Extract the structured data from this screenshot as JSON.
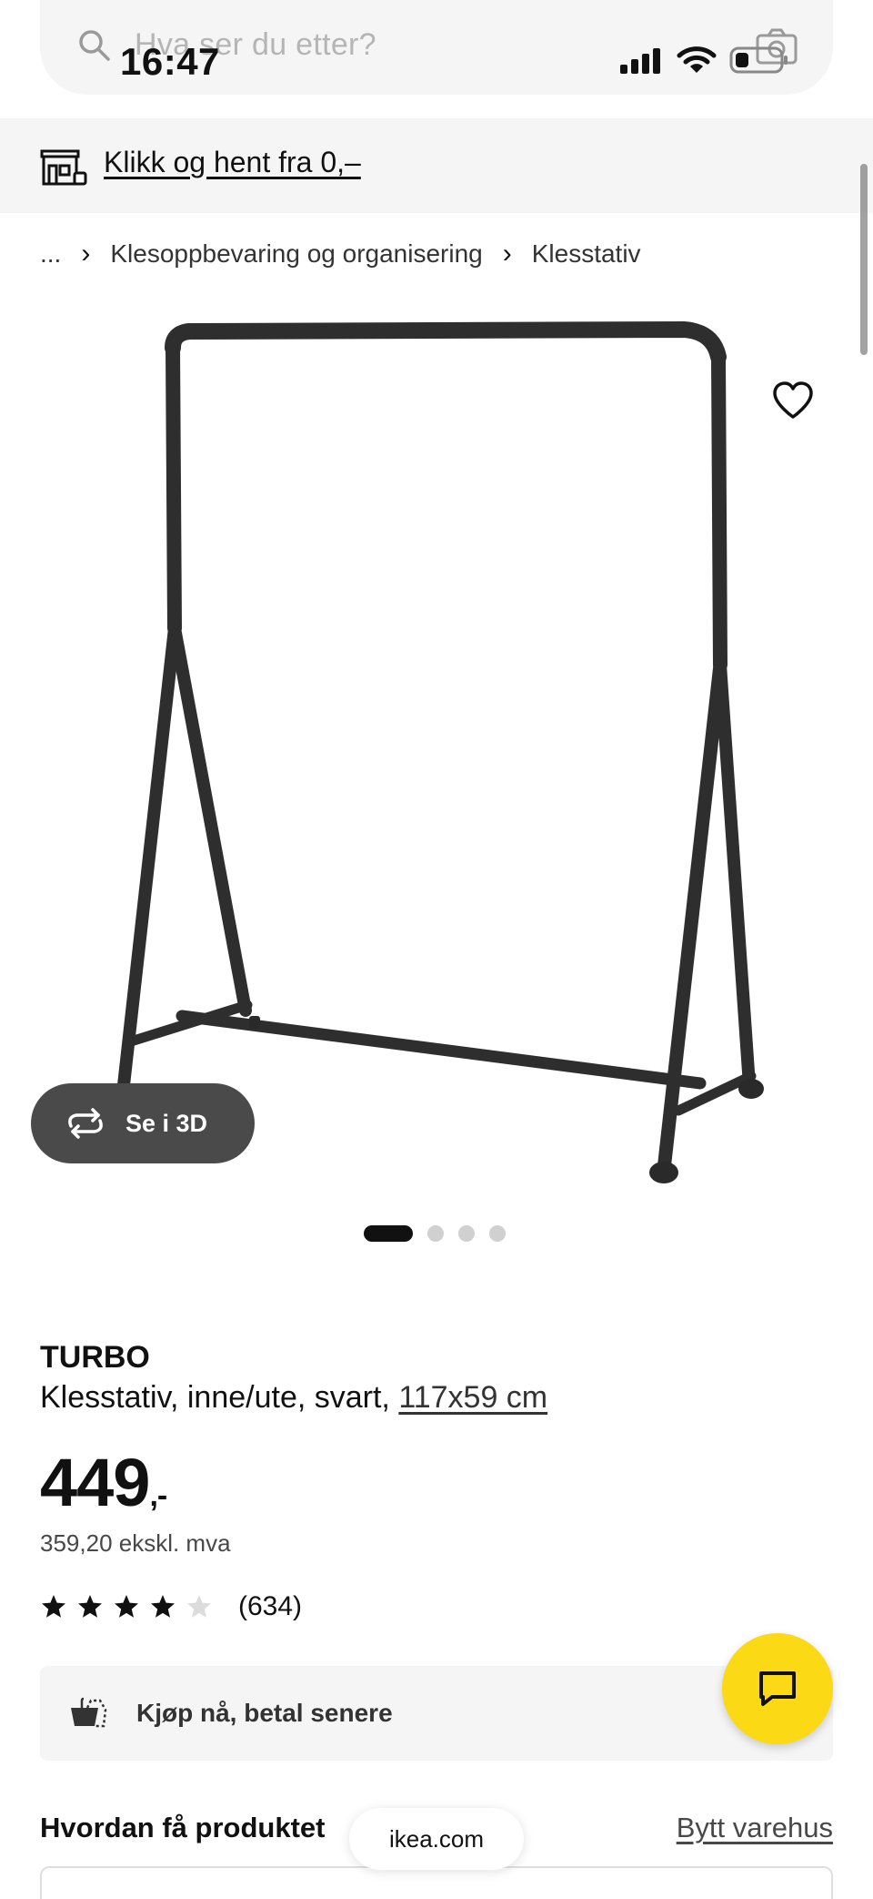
{
  "status_bar": {
    "time": "16:47"
  },
  "search": {
    "placeholder": "Hva ser du etter?"
  },
  "promo": {
    "text": "Klikk og hent fra 0,–"
  },
  "breadcrumb": {
    "items": [
      "...",
      "Klesoppbevaring og organisering",
      "Klesstativ"
    ],
    "separator": "›"
  },
  "gallery": {
    "view_3d_label": "Se i 3D",
    "dot_count": 4,
    "active_index": 0
  },
  "product": {
    "name": "TURBO",
    "description": "Klesstativ, inne/ute, svart, ",
    "size": "117x59 cm",
    "price": "449",
    "price_suffix": ",-",
    "price_ex_vat": "359,20 ekskl. mva",
    "rating": 4,
    "rating_max": 5,
    "review_count": "(634)"
  },
  "bnpl": {
    "label": "Kjøp nå, betal senere"
  },
  "delivery": {
    "title": "Hvordan få produktet",
    "change_store": "Bytt varehus"
  },
  "browser": {
    "url": "ikea.com"
  },
  "colors": {
    "accent_yellow": "#fbd914",
    "panel_gray": "#f5f5f5",
    "text_dark": "#111111",
    "button_dark": "#4a4a4a",
    "star_empty": "#dcdcdc"
  },
  "icons": [
    "search-icon",
    "camera-icon",
    "signal-icon",
    "wifi-icon",
    "battery-icon",
    "store-icon",
    "heart-icon",
    "rotate-3d-icon",
    "star-icon",
    "bnpl-basket-icon",
    "chat-icon"
  ]
}
